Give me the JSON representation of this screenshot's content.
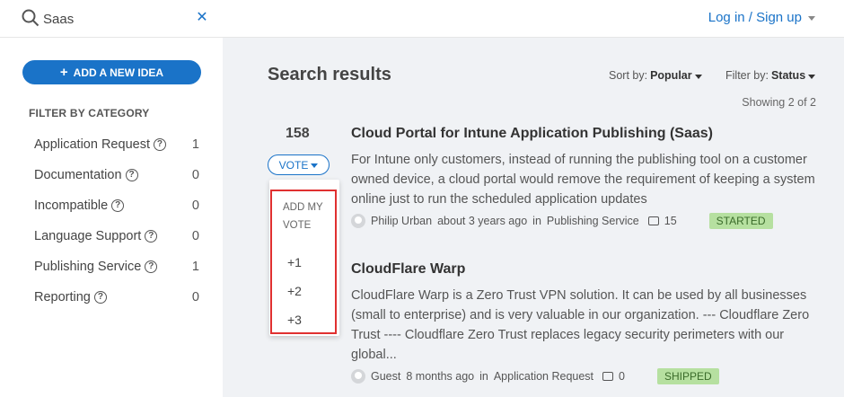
{
  "header": {
    "search_value": "Saas",
    "login_label": "Log in / Sign up"
  },
  "sidebar": {
    "add_idea_label": "ADD A NEW IDEA",
    "filter_title": "FILTER BY CATEGORY",
    "categories": [
      {
        "label": "Application Request",
        "count": "1"
      },
      {
        "label": "Documentation",
        "count": "0"
      },
      {
        "label": "Incompatible",
        "count": "0"
      },
      {
        "label": "Language Support",
        "count": "0"
      },
      {
        "label": "Publishing Service",
        "count": "1"
      },
      {
        "label": "Reporting",
        "count": "0"
      }
    ]
  },
  "main": {
    "title": "Search results",
    "sort_label": "Sort by:",
    "sort_value": "Popular",
    "filter_label": "Filter by:",
    "filter_value": "Status",
    "showing": "Showing 2 of 2",
    "vote_count": "158",
    "vote_button": "VOTE",
    "vote_menu": {
      "header": "ADD MY VOTE",
      "options": [
        "+1",
        "+2",
        "+3"
      ]
    },
    "ideas": [
      {
        "title": "Cloud Portal for Intune Application Publishing (Saas)",
        "description": "For Intune only customers, instead of running the publishing tool on a customer owned device, a cloud portal would remove the requirement of keeping a system online just to run the scheduled application updates",
        "author": "Philip Urban",
        "time": "about 3 years ago",
        "in_text": "in",
        "category": "Publishing Service",
        "comments": "15",
        "status": "STARTED"
      },
      {
        "title": "CloudFlare Warp",
        "description": "CloudFlare Warp is a Zero Trust VPN solution. It can be used by all businesses (small to enterprise) and is very valuable in our organization. --- Cloudflare Zero Trust ---- Cloudflare Zero Trust replaces legacy security perimeters with our global...",
        "author": "Guest",
        "time": "8 months ago",
        "in_text": "in",
        "category": "Application Request",
        "comments": "0",
        "status": "SHIPPED"
      }
    ]
  },
  "colors": {
    "accent": "#1a73c8",
    "highlight": "#e03030",
    "status_bg": "#b6e0a0"
  }
}
